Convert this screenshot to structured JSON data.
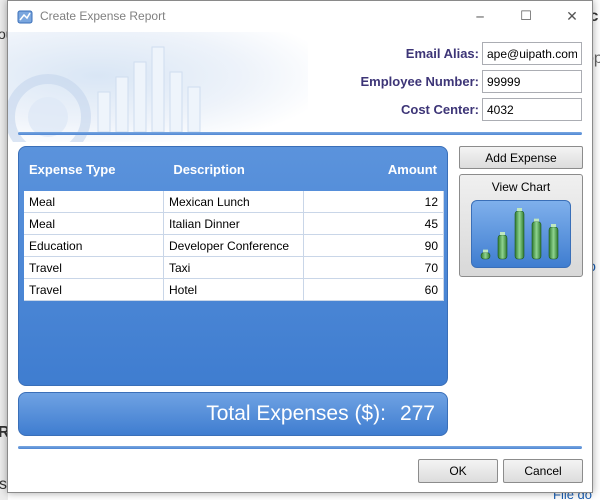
{
  "window": {
    "title": "Create Expense Report",
    "minimize_glyph": "─",
    "maximize_glyph": "☐",
    "close_glyph": "✕"
  },
  "form": {
    "email_label": "Email Alias:",
    "email_value": "ape@uipath.com",
    "employee_label": "Employee Number:",
    "employee_value": "99999",
    "cost_center_label": "Cost Center:",
    "cost_center_value": "4032"
  },
  "grid": {
    "columns": [
      "Expense Type",
      "Description",
      "Amount"
    ],
    "rows": [
      {
        "type": "Meal",
        "description": "Mexican Lunch",
        "amount": "12"
      },
      {
        "type": "Meal",
        "description": "Italian Dinner",
        "amount": "45"
      },
      {
        "type": "Education",
        "description": "Developer Conference",
        "amount": "90"
      },
      {
        "type": "Travel",
        "description": "Taxi",
        "amount": "70"
      },
      {
        "type": "Travel",
        "description": "Hotel",
        "amount": "60"
      }
    ]
  },
  "total": {
    "label": "Total Expenses ($):",
    "value": "277"
  },
  "buttons": {
    "add_expense": "Add Expense",
    "view_chart": "View Chart",
    "ok": "OK",
    "cancel": "Cancel"
  },
  "chart_preview": {
    "values": [
      12,
      45,
      90,
      70,
      60
    ]
  },
  "background": {
    "fragments": [
      "ou",
      "op",
      "ic",
      "R",
      "s",
      "lo",
      "g",
      "F",
      "File do"
    ]
  }
}
